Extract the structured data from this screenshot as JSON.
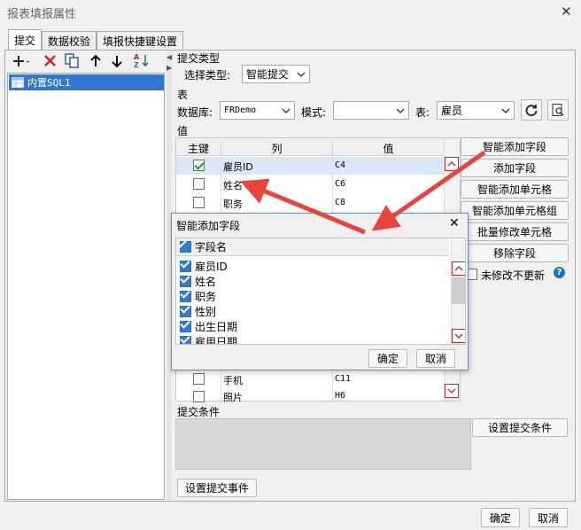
{
  "window": {
    "title": "报表填报属性",
    "close": "✕"
  },
  "tabs": [
    "提交",
    "数据校验",
    "填报快捷键设置"
  ],
  "left_tree": {
    "item": "内置SQL1"
  },
  "submit_type": {
    "section": "提交类型",
    "label": "选择类型:",
    "value": "智能提交"
  },
  "table_section": {
    "section": "表",
    "db_label": "数据库:",
    "db_value": "FRDemo",
    "mode_label": "模式:",
    "mode_value": "",
    "table_label": "表:",
    "table_value": "雇员"
  },
  "values_section": {
    "section": "值",
    "headers": [
      "主键",
      "列",
      "值"
    ],
    "rows": [
      {
        "key": true,
        "col": "雇员ID",
        "val": "C4"
      },
      {
        "key": false,
        "col": "姓名",
        "val": "C6"
      },
      {
        "key": false,
        "col": "职务",
        "val": "C8"
      }
    ],
    "bottom_rows": [
      {
        "key": false,
        "col": "手机",
        "val": "C11"
      },
      {
        "key": false,
        "col": "照片",
        "val": "H6"
      }
    ]
  },
  "right_buttons": [
    "智能添加字段",
    "添加字段",
    "智能添加单元格",
    "智能添加单元格组",
    "批量修改单元格",
    "移除字段"
  ],
  "no_update": {
    "label": "未修改不更新",
    "help": "?"
  },
  "submit_condition": {
    "section": "提交条件",
    "button": "设置提交条件"
  },
  "event_button": "设置提交事件",
  "footer": {
    "ok": "确定",
    "cancel": "取消"
  },
  "dialog": {
    "title": "智能添加字段",
    "close": "✕",
    "header": "字段名",
    "fields": [
      "雇员ID",
      "姓名",
      "职务",
      "性别",
      "出生日期",
      "雇用日期"
    ],
    "ok": "确定",
    "cancel": "取消"
  },
  "colors": {
    "arrow": "#e8443a",
    "selection": "#3378d0",
    "accent": "#1e73be"
  }
}
